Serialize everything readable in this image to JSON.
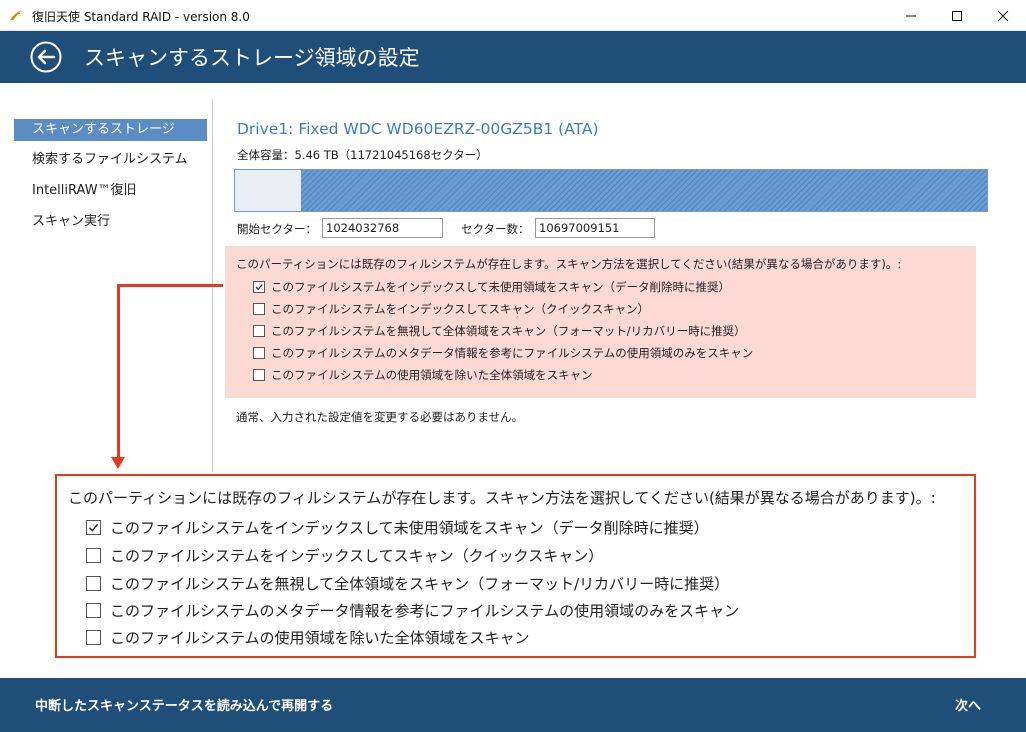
{
  "window": {
    "title": "復旧天使 Standard RAID - version 8.0",
    "icon": "app-logo-icon",
    "controls": [
      "minimize-icon",
      "maximize-icon",
      "close-icon"
    ]
  },
  "header": {
    "back_icon": "back-arrow-icon",
    "title": "スキャンするストレージ領域の設定"
  },
  "sidebar": {
    "items": [
      {
        "label": "スキャンするストレージ",
        "active": true
      },
      {
        "label": "検索するファイルシステム",
        "active": false
      },
      {
        "label": "IntelliRAW™復旧",
        "active": false
      },
      {
        "label": "スキャン実行",
        "active": false
      }
    ]
  },
  "drive": {
    "title": "Drive1: Fixed WDC WD60EZRZ-00GZ5B1 (ATA)",
    "capacity": "全体容量：5.46 TB（11721045168セクター）",
    "selected_fraction": 0.912
  },
  "fields": {
    "start_sector_label": "開始セクター：",
    "start_sector_value": "1024032768",
    "sector_count_label": "セクター数：",
    "sector_count_value": "10697009151"
  },
  "scan_options": {
    "heading": "このパーティションには既存のフィルシステムが存在します。スキャン方法を選択してください(結果が異なる場合があります)。:",
    "options": [
      {
        "label": "このファイルシステムをインデックスして未使用領域をスキャン（データ削除時に推奨）",
        "checked": true
      },
      {
        "label": "このファイルシステムをインデックスしてスキャン（クイックスキャン）",
        "checked": false
      },
      {
        "label": "このファイルシステムを無視して全体領域をスキャン（フォーマット/リカバリー時に推奨）",
        "checked": false
      },
      {
        "label": "このファイルシステムのメタデータ情報を参考にファイルシステムの使用領域のみをスキャン",
        "checked": false
      },
      {
        "label": "このファイルシステムの使用領域を除いた全体領域をスキャン",
        "checked": false
      }
    ]
  },
  "note": "通常、入力された設定値を変更する必要はありません。",
  "footer": {
    "resume_label": "中断したスキャンステータスを読み込んで再開する",
    "next_label": "次へ"
  },
  "colors": {
    "header_bg": "#1f4e79",
    "active_nav": "#5b8cc4",
    "drive_title": "#3d7cc0",
    "panel_bg": "#fdd9d3",
    "highlight": "#e53a1e"
  }
}
